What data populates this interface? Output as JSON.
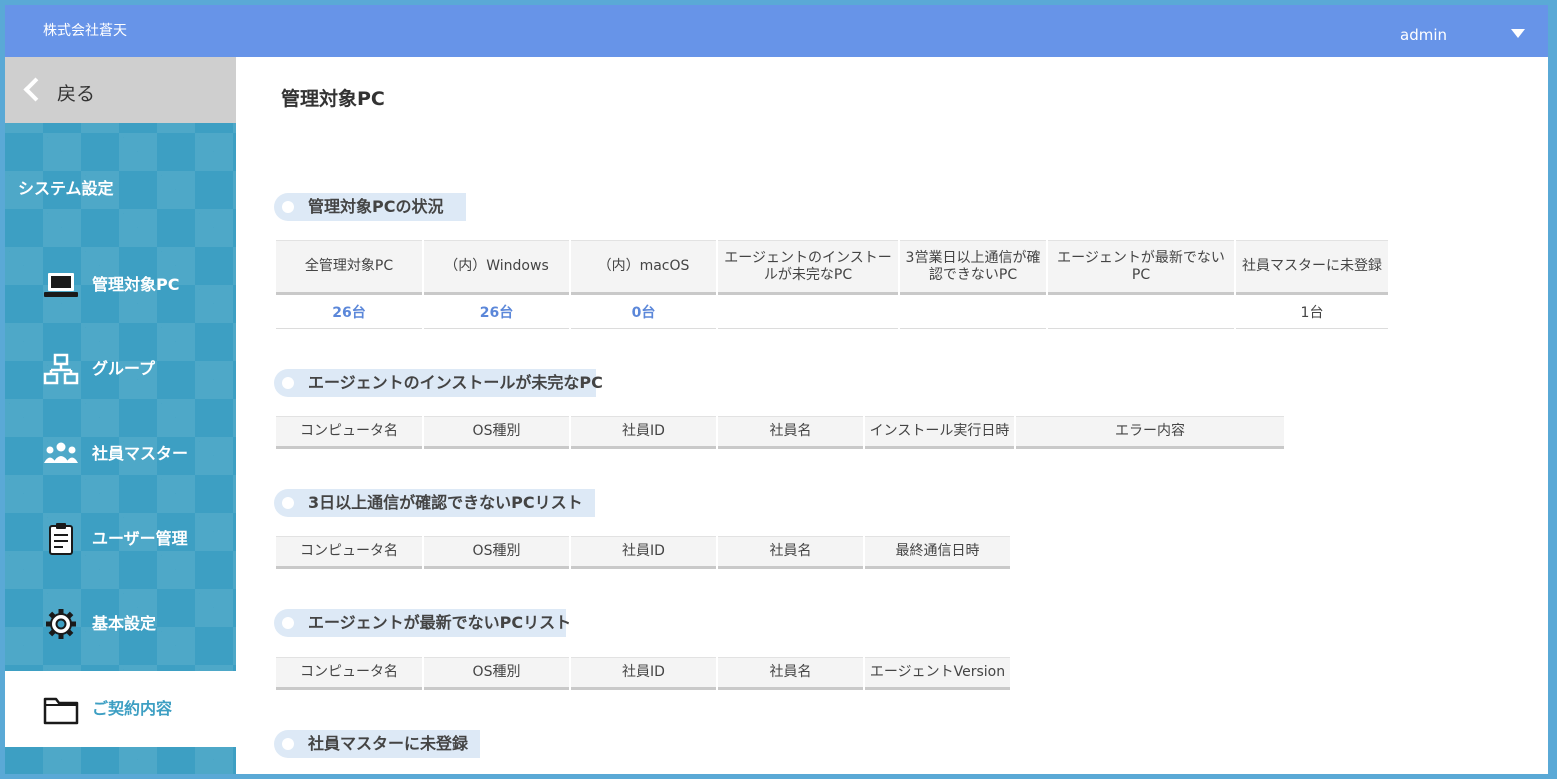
{
  "header": {
    "company": "株式会社蒼天",
    "user": "admin"
  },
  "sidebar": {
    "back_label": "戻る",
    "section_title": "システム設定",
    "items": [
      {
        "label": "管理対象PC",
        "icon": "laptop-icon"
      },
      {
        "label": "グループ",
        "icon": "org-chart-icon"
      },
      {
        "label": "社員マスター",
        "icon": "people-icon"
      },
      {
        "label": "ユーザー管理",
        "icon": "clipboard-icon"
      },
      {
        "label": "基本設定",
        "icon": "gear-icon"
      },
      {
        "label": "ご契約内容",
        "icon": "folder-icon",
        "active": true
      }
    ]
  },
  "main": {
    "title": "管理対象PC",
    "status": {
      "heading": "管理対象PCの状況",
      "headers": [
        "全管理対象PC",
        "（内）Windows",
        "（内）macOS",
        "エージェントのインストールが未完なPC",
        "3営業日以上通信が確認できないPC",
        "エージェントが最新でないPC",
        "社員マスターに未登録"
      ],
      "values": [
        "26台",
        "26台",
        "0台",
        "",
        "",
        "",
        "1台"
      ]
    },
    "install": {
      "heading": "エージェントのインストールが未完なPC",
      "headers": [
        "コンピュータ名",
        "OS種別",
        "社員ID",
        "社員名",
        "インストール実行日時",
        "エラー内容"
      ]
    },
    "nocomm": {
      "heading": "3日以上通信が確認できないPCリスト",
      "headers": [
        "コンピュータ名",
        "OS種別",
        "社員ID",
        "社員名",
        "最終通信日時"
      ]
    },
    "outdated": {
      "heading": "エージェントが最新でないPCリスト",
      "headers": [
        "コンピュータ名",
        "OS種別",
        "社員ID",
        "社員名",
        "エージェントVersion"
      ]
    },
    "unregistered": {
      "heading": "社員マスターに未登録"
    }
  }
}
